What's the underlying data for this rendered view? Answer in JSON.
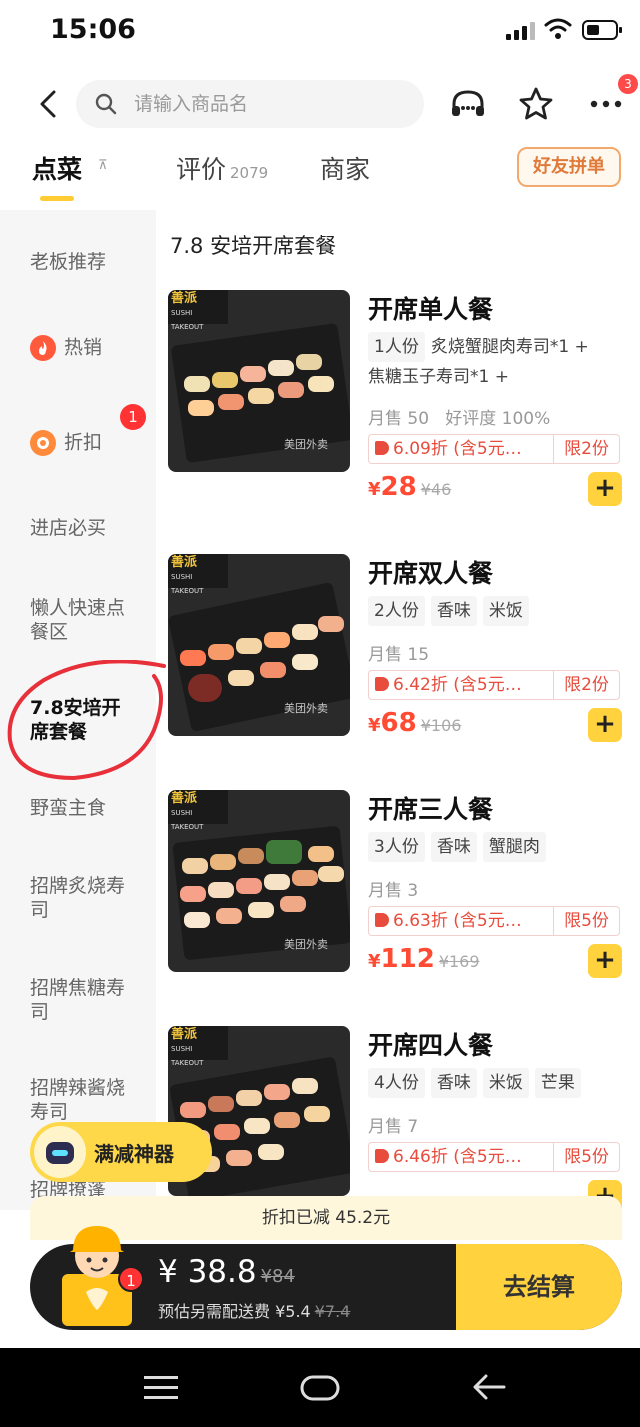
{
  "status": {
    "time": "15:06"
  },
  "header": {
    "search_placeholder": "请输入商品名",
    "notification_count": "3"
  },
  "tabs": {
    "order": "点菜",
    "pin": "⊼",
    "reviews": "评价",
    "reviews_count": "2079",
    "merchant": "商家",
    "group_order": "好友拼单"
  },
  "sidebar": {
    "items": [
      {
        "label": "老板推荐"
      },
      {
        "label": "热销"
      },
      {
        "label": "折扣",
        "badge": "1"
      },
      {
        "label": "进店必买"
      },
      {
        "label": "懒人快速点餐区"
      },
      {
        "label": "7.8安培开席套餐"
      },
      {
        "label": "野蛮主食"
      },
      {
        "label": "招牌炙烧寿司"
      },
      {
        "label": "招牌焦糖寿司"
      },
      {
        "label": "招牌辣酱烧寿司"
      },
      {
        "label": "招牌撩蓬"
      }
    ]
  },
  "section": {
    "title": "7.8 安培开席套餐"
  },
  "products": [
    {
      "name": "开席单人餐",
      "tags": [
        "1人份",
        "炙烧蟹腿肉寿司*1 +",
        "焦糖玉子寿司*1 +"
      ],
      "sales": "月售 50",
      "rating": "好评度 100%",
      "discount": "6.09折 (含5元…",
      "limit": "限2份",
      "price": "28",
      "orig_price": "¥46",
      "brand": "善派",
      "brand_sub": "SUSHI TAKEOUT",
      "watermark": "美团外卖"
    },
    {
      "name": "开席双人餐",
      "tags": [
        "2人份",
        "香味",
        "米饭"
      ],
      "sales": "月售 15",
      "rating": "",
      "discount": "6.42折 (含5元…",
      "limit": "限2份",
      "price": "68",
      "orig_price": "¥106",
      "brand": "善派",
      "brand_sub": "SUSHI TAKEOUT",
      "watermark": "美团外卖"
    },
    {
      "name": "开席三人餐",
      "tags": [
        "3人份",
        "香味",
        "蟹腿肉"
      ],
      "sales": "月售 3",
      "rating": "",
      "discount": "6.63折 (含5元…",
      "limit": "限5份",
      "price": "112",
      "orig_price": "¥169",
      "brand": "善派",
      "brand_sub": "SUSHI TAKEOUT",
      "watermark": "美团外卖"
    },
    {
      "name": "开席四人餐",
      "tags": [
        "4人份",
        "香味",
        "米饭",
        "芒果"
      ],
      "sales": "月售 7",
      "rating": "",
      "discount": "6.46折 (含5元…",
      "limit": "限5份",
      "price": "",
      "orig_price": "",
      "brand": "善派",
      "brand_sub": "SUSHI TAKEOUT",
      "watermark": ""
    }
  ],
  "promo": {
    "label": "满减神器"
  },
  "cart": {
    "discount_note": "折扣已减 45.2元",
    "total": "¥ 38.8",
    "total_orig": "¥84",
    "delivery": "预估另需配送费 ¥5.4",
    "delivery_orig": "¥7.4",
    "badge": "1",
    "checkout": "去结算"
  },
  "colors": {
    "accent": "#ffd23e",
    "price": "#ff4b33",
    "bar": "#1e1e1e"
  }
}
